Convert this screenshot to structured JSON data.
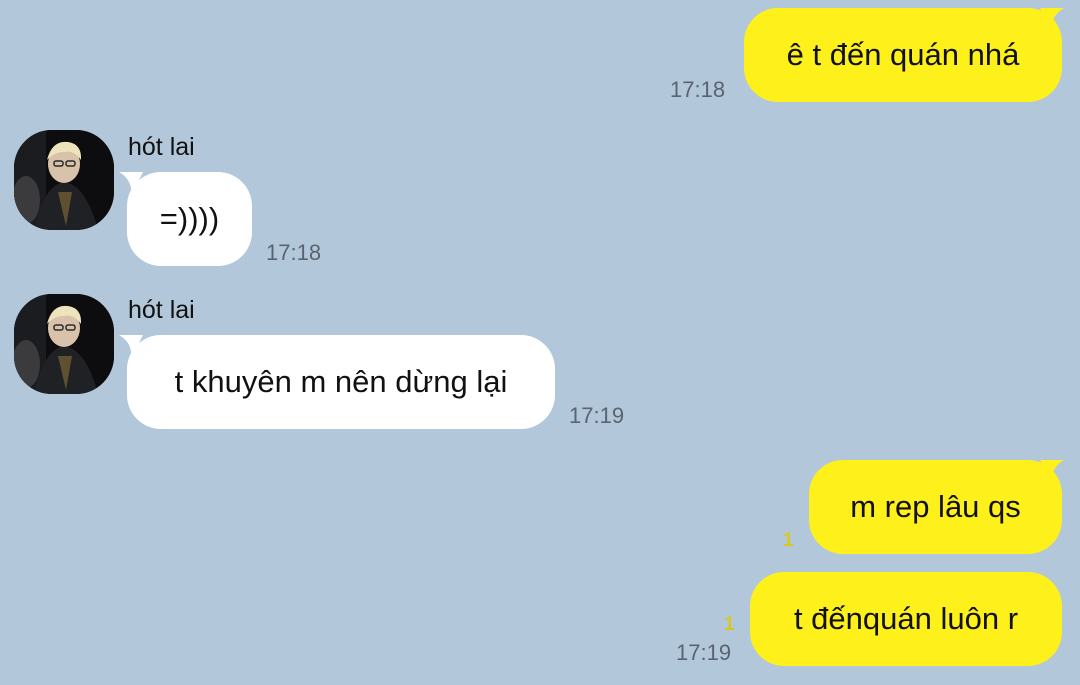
{
  "chat": {
    "messages": [
      {
        "text": "ê t đến quán nhá",
        "time": "17:18"
      },
      {
        "sender": "hót lai",
        "text": "=))))",
        "time": "17:18"
      },
      {
        "sender": "hót lai",
        "text": "t khuyên m nên dừng lại",
        "time": "17:19"
      },
      {
        "text": "m rep lâu qs",
        "unread": "1"
      },
      {
        "text": "t đếnquán luôn r",
        "unread": "1",
        "time": "17:19"
      }
    ]
  },
  "colors": {
    "background": "#b2c7da",
    "outgoing_bubble": "#fef01b",
    "incoming_bubble": "#ffffff",
    "timestamp": "#5a6470",
    "unread_count": "#d8c81e"
  },
  "icons": {
    "avatar": "profile-photo-avatar"
  }
}
